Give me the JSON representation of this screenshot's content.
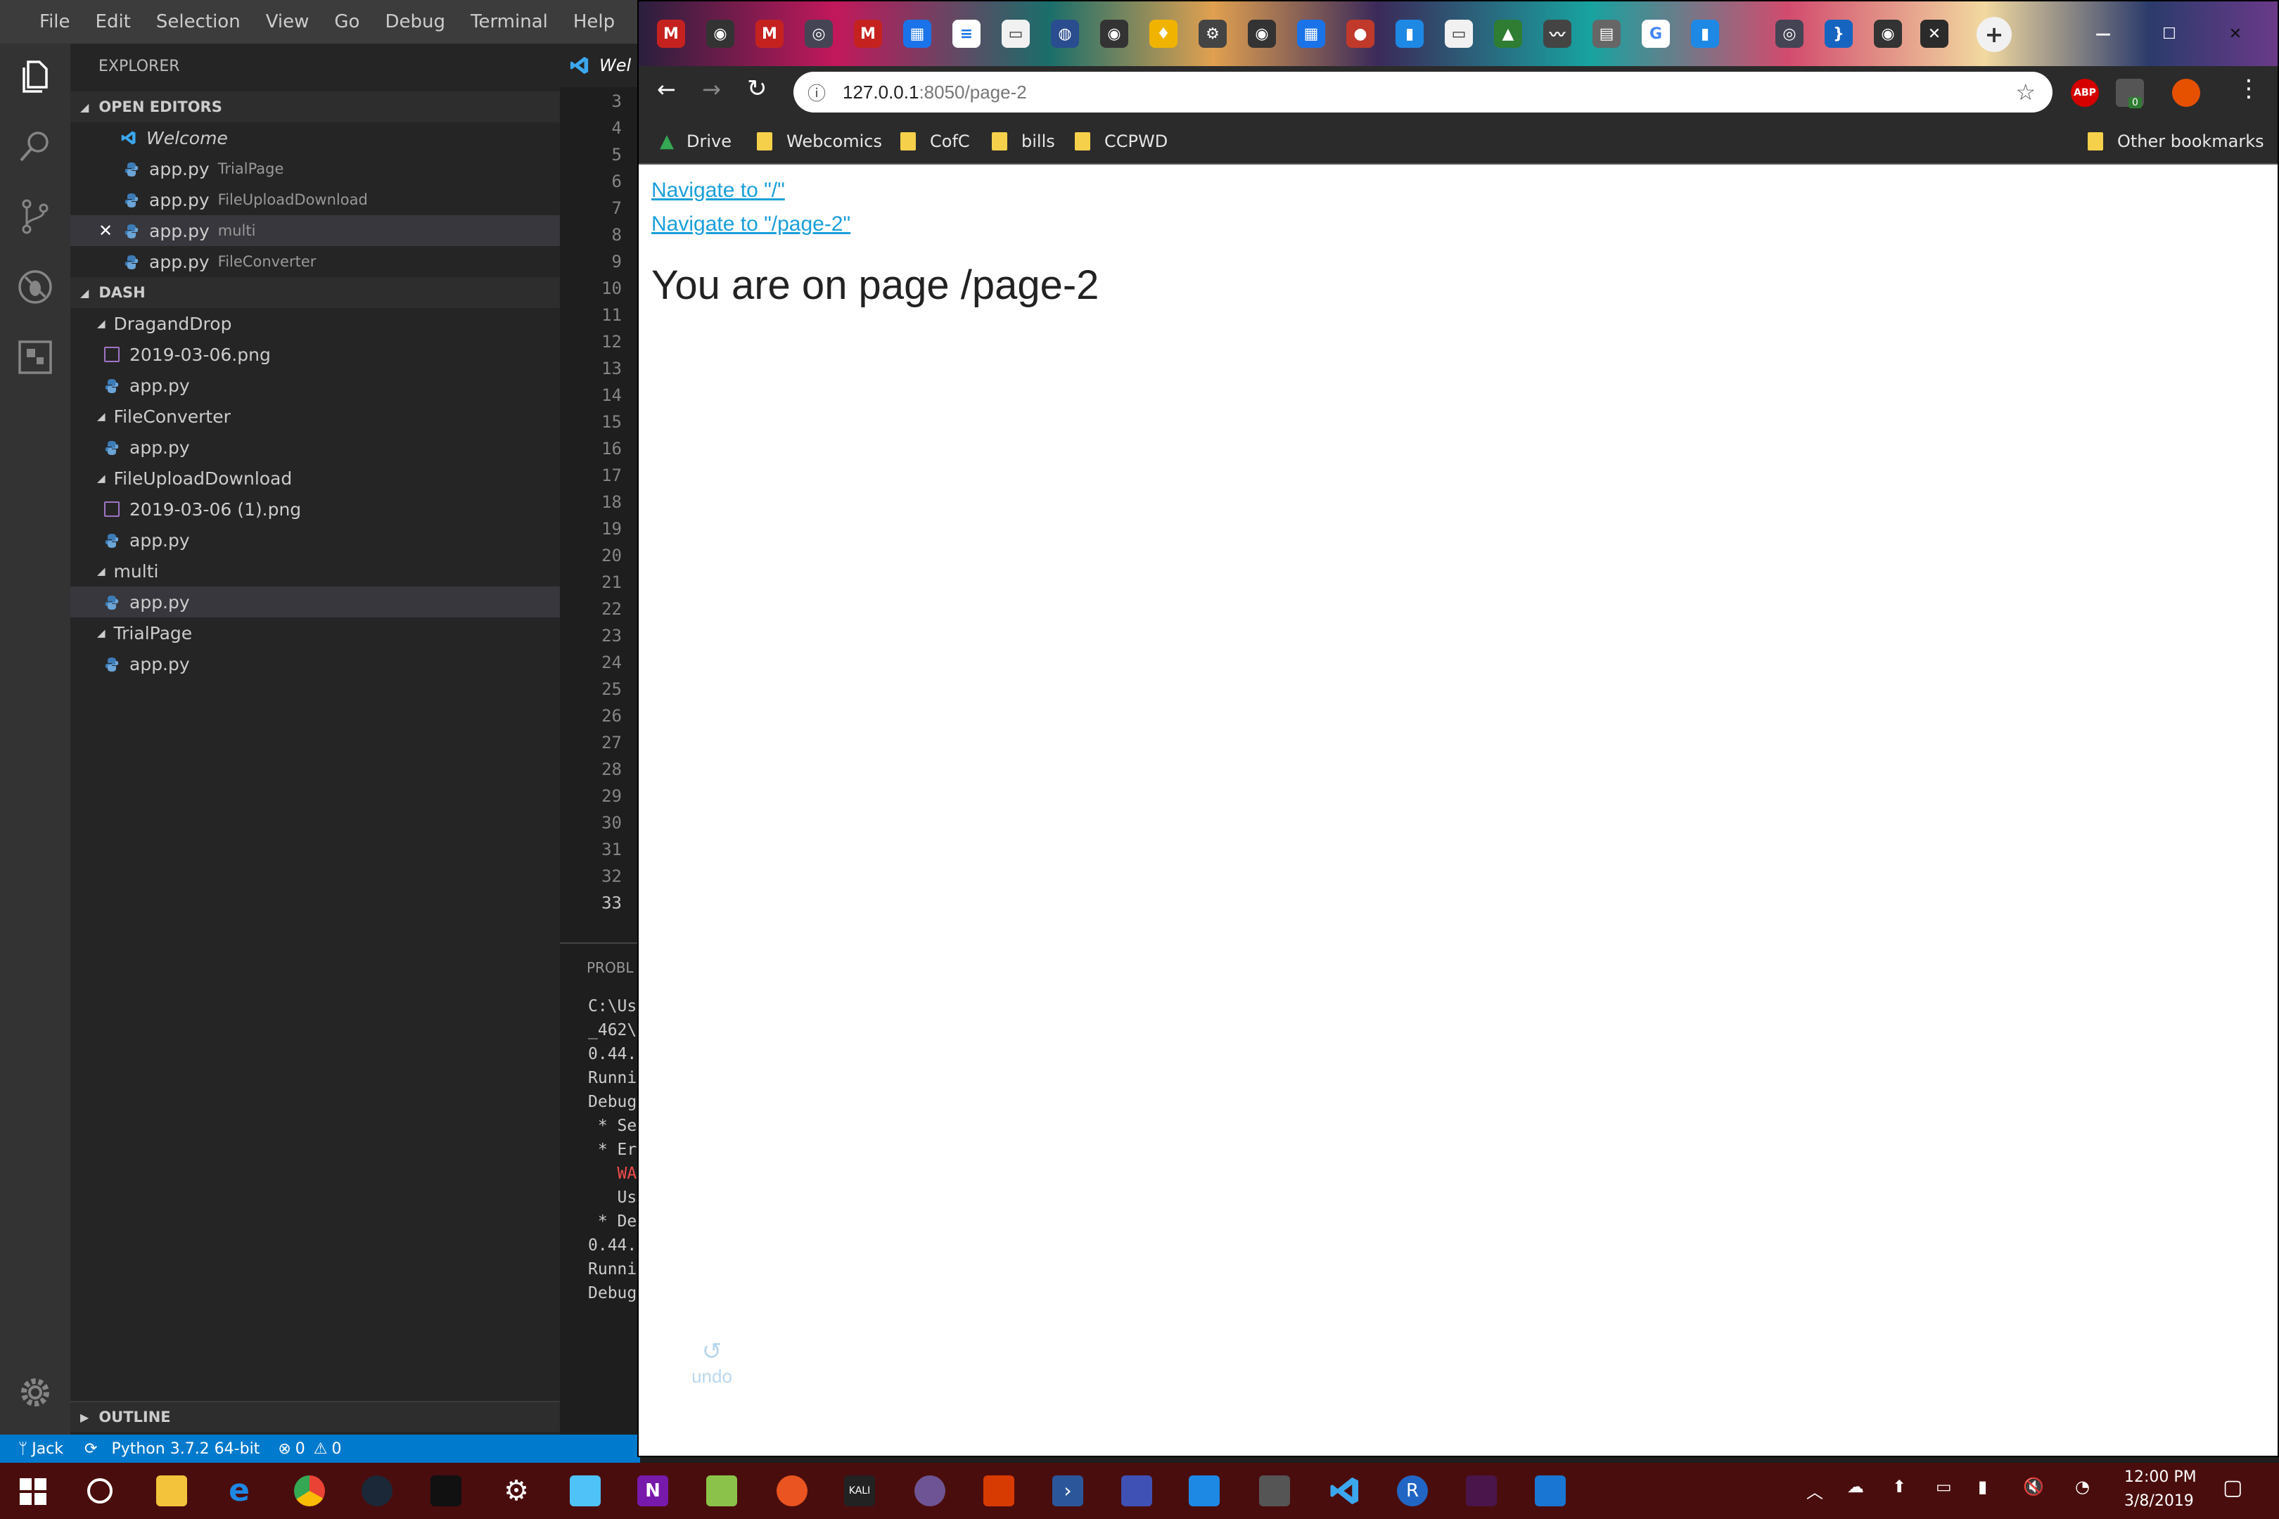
{
  "vscode": {
    "menu": [
      "File",
      "Edit",
      "Selection",
      "View",
      "Go",
      "Debug",
      "Terminal",
      "Help"
    ],
    "tab_label": "Wel",
    "explorer_title": "EXPLORER",
    "open_editors": {
      "title": "OPEN EDITORS",
      "items": [
        {
          "name": "Welcome",
          "sub": ""
        },
        {
          "name": "app.py",
          "sub": "TrialPage"
        },
        {
          "name": "app.py",
          "sub": "FileUploadDownload"
        },
        {
          "name": "app.py",
          "sub": "multi"
        },
        {
          "name": "app.py",
          "sub": "FileConverter"
        }
      ]
    },
    "workspace": {
      "title": "DASH",
      "folders": [
        {
          "name": "DragandDrop",
          "files": [
            "2019-03-06.png",
            "app.py"
          ]
        },
        {
          "name": "FileConverter",
          "files": [
            "app.py"
          ]
        },
        {
          "name": "FileUploadDownload",
          "files": [
            "2019-03-06 (1).png",
            "app.py"
          ]
        },
        {
          "name": "multi",
          "files": [
            "app.py"
          ]
        },
        {
          "name": "TrialPage",
          "files": [
            "app.py"
          ]
        }
      ]
    },
    "outline_title": "OUTLINE",
    "line_numbers": [
      "3",
      "4",
      "5",
      "6",
      "7",
      "8",
      "9",
      "10",
      "11",
      "12",
      "13",
      "14",
      "15",
      "16",
      "17",
      "18",
      "19",
      "20",
      "21",
      "22",
      "23",
      "24",
      "25",
      "26",
      "27",
      "28",
      "29",
      "30",
      "31",
      "32",
      "33"
    ],
    "panel_tab": "PROBL",
    "terminal_lines": [
      "C:\\Us",
      "_462\\",
      "0.44.",
      "Runni",
      "Debug",
      " * Se",
      " * Er",
      "   WA",
      "   Us",
      " * De",
      "0.44.",
      "Runni",
      "Debug"
    ],
    "status": {
      "branch": "Jack",
      "python": "Python 3.7.2 64-bit",
      "errors": "0",
      "warnings": "0"
    }
  },
  "chrome": {
    "url_host": "127.0.0.1",
    "url_path": ":8050/page-2",
    "bookmarks": [
      "Drive",
      "Webcomics",
      "CofC",
      "bills",
      "CCPWD"
    ],
    "other_bookmarks": "Other bookmarks",
    "abp_label": "ABP",
    "ext_badge": "0",
    "page": {
      "links": [
        "Navigate to \"/\"",
        "Navigate to \"/page-2\""
      ],
      "heading": "You are on page /page-2",
      "undo_label": "undo"
    }
  },
  "taskbar": {
    "time": "12:00 PM",
    "date": "3/8/2019",
    "kali_label": "KALI"
  }
}
